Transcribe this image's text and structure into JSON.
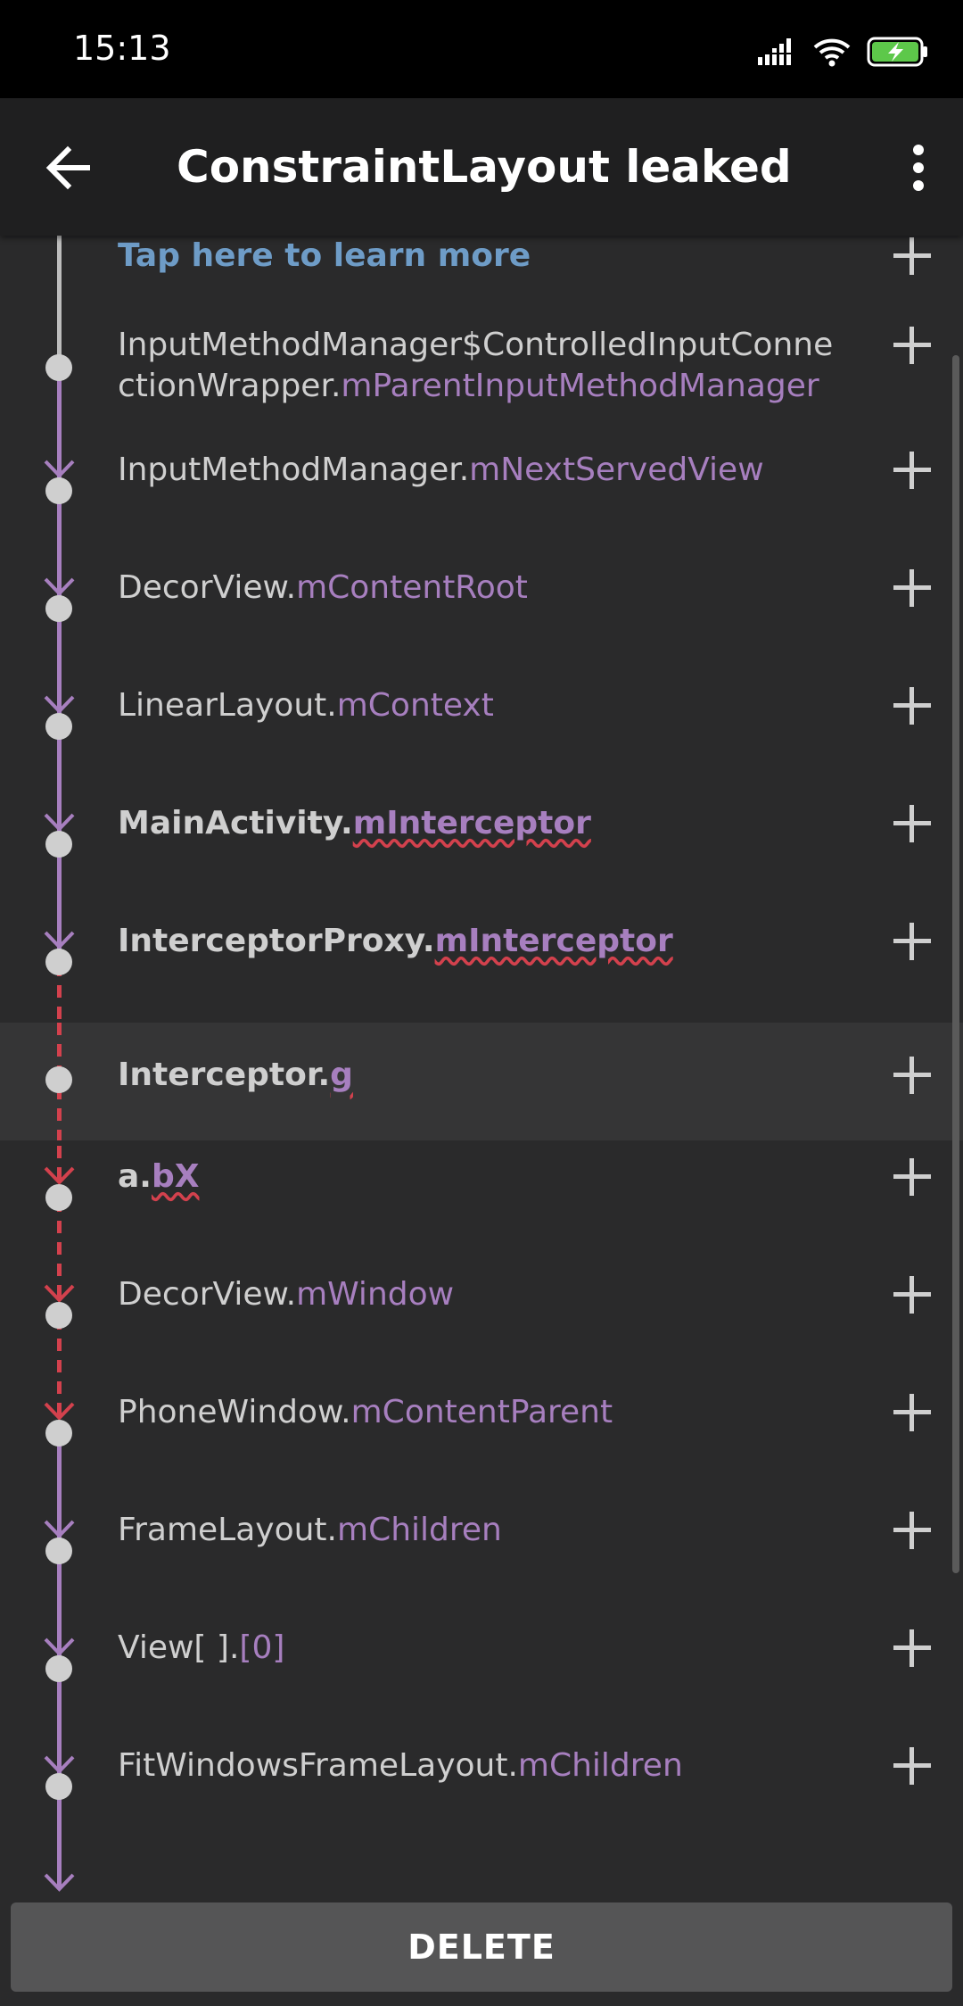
{
  "status_bar": {
    "time": "15:13",
    "signal_icon": "signal-icon",
    "wifi_icon": "wifi-icon",
    "battery_icon": "battery-charging-icon"
  },
  "appbar": {
    "title": "ConstraintLayout leaked",
    "back_icon": "back-arrow-icon",
    "menu_icon": "more-vert-icon"
  },
  "trace": {
    "learn_more": "Tap here to learn more",
    "items": [
      {
        "cls": "InputMethodManager$ControlledInputConnectionWrapper.",
        "field": "mParentInputMethodManager"
      },
      {
        "cls": "InputMethodManager.",
        "field": "mNextServedView"
      },
      {
        "cls": "DecorView.",
        "field": "mContentRoot"
      },
      {
        "cls": "LinearLayout.",
        "field": "mContext"
      },
      {
        "cls": "MainActivity.",
        "field": "mInterceptor"
      },
      {
        "cls": "InterceptorProxy.",
        "field": "mInterceptor"
      },
      {
        "cls": "Interceptor.",
        "field": "g"
      },
      {
        "cls": "a.",
        "field": "bX"
      },
      {
        "cls": "DecorView.",
        "field": "mWindow"
      },
      {
        "cls": "PhoneWindow.",
        "field": "mContentParent"
      },
      {
        "cls": "FrameLayout.",
        "field": "mChildren"
      },
      {
        "cls": "View[ ].",
        "field": "[0]"
      },
      {
        "cls": "FitWindowsFrameLayout.",
        "field": "mChildren"
      }
    ]
  },
  "colors": {
    "field": "#a77fbf",
    "leak": "#d3414d",
    "link": "#6e9cc7",
    "background": "#2a2a2b"
  },
  "footer": {
    "delete_label": "DELETE"
  }
}
